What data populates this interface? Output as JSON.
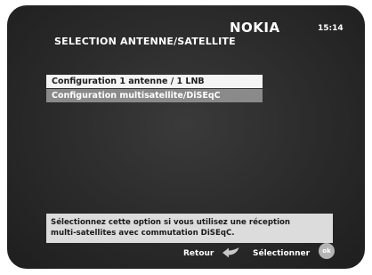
{
  "header": {
    "brand": "NOKIA",
    "time": "15:14",
    "title": "SELECTION ANTENNE/SATELLITE"
  },
  "menu": {
    "items": [
      {
        "label": "Configuration 1 antenne / 1 LNB",
        "selected": true
      },
      {
        "label": "Configuration multisatellite/DiSEqC",
        "selected": false
      }
    ]
  },
  "help": {
    "line1": "Sélectionnez cette option si vous utilisez une réception",
    "line2": "multi-satellites avec commutation DiSEqC."
  },
  "footer": {
    "back_label": "Retour",
    "back_icon": "back-arrow-icon",
    "select_label": "Sélectionner",
    "ok_label": "ok",
    "ok_icon": "ok-button-icon"
  },
  "colors": {
    "background": "#2a2a2a",
    "selected_item": "#f4f4f4",
    "normal_item": "#8a8a8a",
    "help_box": "#dcdcdc"
  }
}
